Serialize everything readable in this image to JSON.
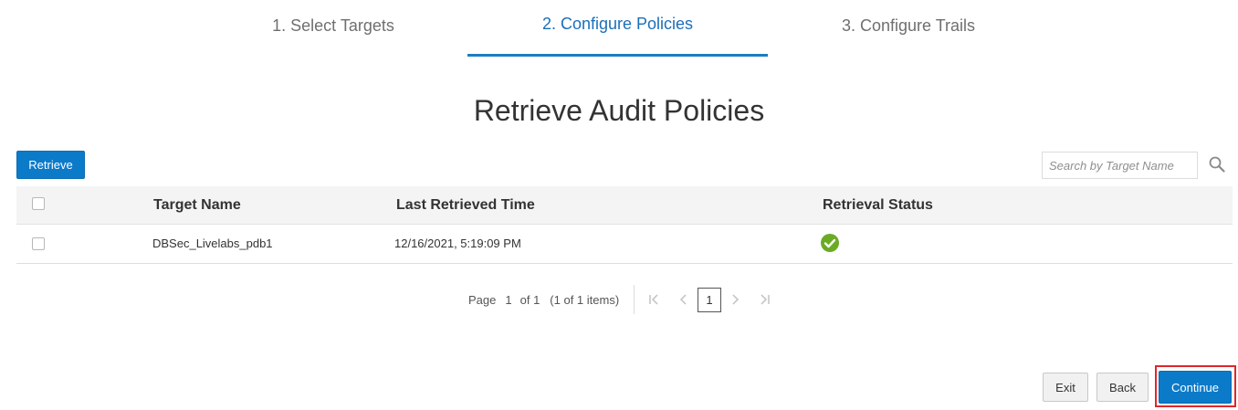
{
  "train": {
    "steps": [
      {
        "label": "1. Select Targets",
        "active": false
      },
      {
        "label": "2. Configure Policies",
        "active": true
      },
      {
        "label": "3. Configure Trails",
        "active": false
      }
    ]
  },
  "page_title": "Retrieve Audit Policies",
  "toolbar": {
    "retrieve_label": "Retrieve",
    "search": {
      "placeholder": "Search by Target Name",
      "value": ""
    }
  },
  "table": {
    "columns": [
      "Target Name",
      "Last Retrieved Time",
      "Retrieval Status"
    ],
    "rows": [
      {
        "target_name": "DBSec_Livelabs_pdb1",
        "last_retrieved": "12/16/2021, 5:19:09 PM",
        "status": "success"
      }
    ]
  },
  "pagination": {
    "page_label": "Page",
    "page": "1",
    "of_label": "of 1",
    "items_label": "(1 of 1 items)",
    "current": "1"
  },
  "footer": {
    "exit_label": "Exit",
    "back_label": "Back",
    "continue_label": "Continue"
  },
  "colors": {
    "accent": "#0b7ac9",
    "active_step": "#1b6fb8",
    "success": "#6aab24",
    "highlight": "#e0262b"
  },
  "icons": {
    "search": "search-icon",
    "status": "check-circle-icon",
    "first": "first-page-icon",
    "prev": "prev-page-icon",
    "next": "next-page-icon",
    "last": "last-page-icon"
  }
}
